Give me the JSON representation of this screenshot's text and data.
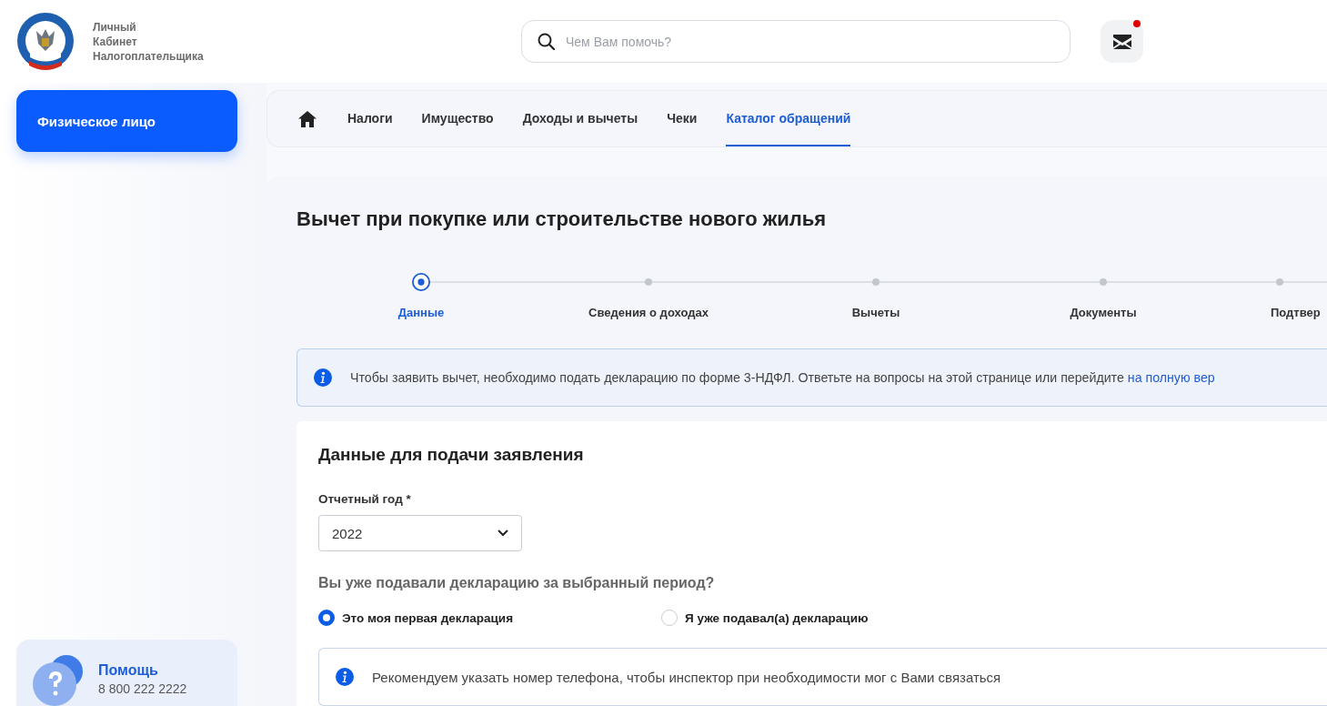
{
  "header": {
    "logo_text": [
      "Личный",
      "Кабинет",
      "Налогоплательщика"
    ],
    "search": {
      "placeholder": "Чем Вам помочь?"
    },
    "messages": {
      "unread": true
    }
  },
  "sidebar": {
    "account_button": "Физическое лицо",
    "help": {
      "title": "Помощь",
      "phone": "8 800 222 2222"
    }
  },
  "nav": {
    "tabs": [
      {
        "label": "Налоги",
        "selected": false
      },
      {
        "label": "Имущество",
        "selected": false
      },
      {
        "label": "Доходы и вычеты",
        "selected": false
      },
      {
        "label": "Чеки",
        "selected": false
      },
      {
        "label": "Каталог обращений",
        "selected": true
      }
    ]
  },
  "page": {
    "title": "Вычет при покупке или строительстве нового жилья",
    "steps": [
      {
        "label": "Данные",
        "selected": true
      },
      {
        "label": "Сведения о доходах",
        "selected": false
      },
      {
        "label": "Вычеты",
        "selected": false
      },
      {
        "label": "Документы",
        "selected": false
      },
      {
        "label": "Подтвер",
        "selected": false
      }
    ],
    "notice": {
      "text": "Чтобы заявить вычет, необходимо подать декларацию по форме 3-НДФЛ. Ответьте на вопросы на этой странице или перейдите",
      "link": "на полную вер"
    },
    "form": {
      "title": "Данные для подачи заявления",
      "year": {
        "label": "Отчетный год *",
        "value": "2022"
      },
      "question": "Вы уже подавали декларацию за выбранный период?",
      "options": [
        {
          "label": "Это моя первая декларация",
          "selected": true
        },
        {
          "label": "Я уже подавал(а) декларацию",
          "selected": false
        }
      ],
      "hint": "Рекомендуем указать номер телефона, чтобы инспектор при необходимости мог с Вами связаться"
    }
  }
}
